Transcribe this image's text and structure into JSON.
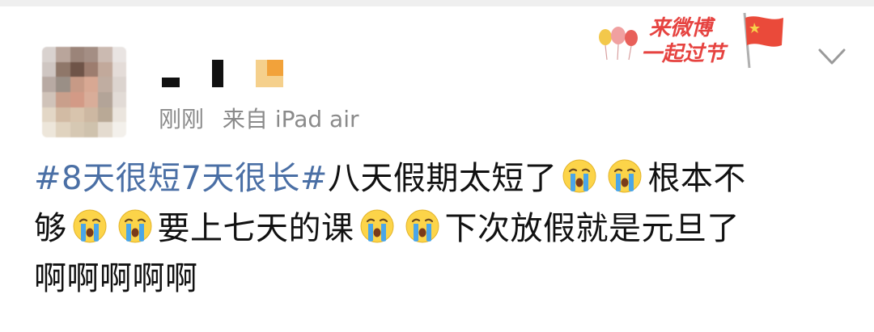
{
  "post": {
    "time": "刚刚",
    "source": "来自 iPad air",
    "badge": {
      "line1": "来微博",
      "line2": "一起过节"
    },
    "text": {
      "topic": "#8天很短7天很长#",
      "line1_after_topic": "八天假期太短了",
      "line1_end": "根本不",
      "line2_start": "够",
      "line2_mid": "要上七天的课",
      "line2_end": "下次放假就是元旦了",
      "line3": "啊啊啊啊啊"
    }
  },
  "colors": {
    "topic": "#4a6fa5",
    "badge": "#e64340",
    "meta": "#8a8a8a"
  },
  "icons": {
    "emoji": "crying-face-icon",
    "more": "chevron-down-icon"
  }
}
